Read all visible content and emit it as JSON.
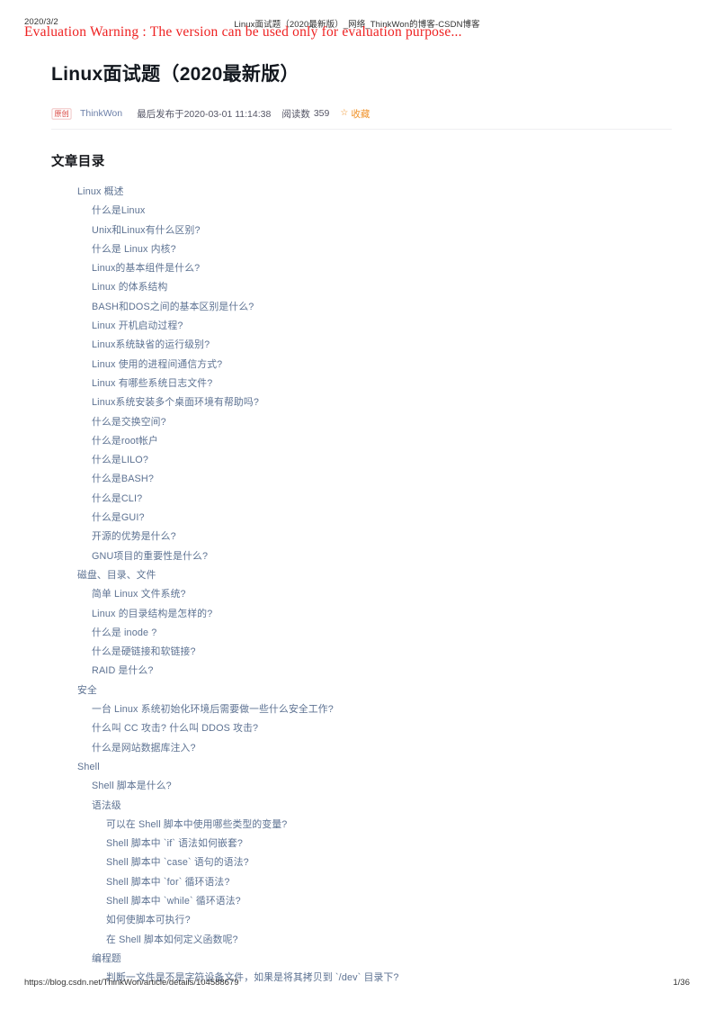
{
  "print_header": {
    "date": "2020/3/2",
    "title": "Linux面试题（2020最新版）_网络_ThinkWon的博客-CSDN博客"
  },
  "watermark": {
    "text": "Evaluation Warning : The version can be used only for evaluation purpose...",
    "color": "#ee2222"
  },
  "article": {
    "title": "Linux面试题（2020最新版）",
    "meta": {
      "badge": "原创",
      "author": "ThinkWon",
      "published": "最后发布于2020-03-01 11:14:38",
      "reads_label": "阅读数",
      "reads_count": "359",
      "favorite_icon": "star-icon",
      "favorite_label": "收藏"
    },
    "toc_heading": "文章目录",
    "toc": [
      {
        "level": 1,
        "label": "Linux 概述"
      },
      {
        "level": 2,
        "label": "什么是Linux"
      },
      {
        "level": 2,
        "label": "Unix和Linux有什么区别?"
      },
      {
        "level": 2,
        "label": "什么是 Linux 内核?"
      },
      {
        "level": 2,
        "label": "Linux的基本组件是什么?"
      },
      {
        "level": 2,
        "label": "Linux 的体系结构"
      },
      {
        "level": 2,
        "label": "BASH和DOS之间的基本区别是什么?"
      },
      {
        "level": 2,
        "label": "Linux 开机启动过程?"
      },
      {
        "level": 2,
        "label": "Linux系统缺省的运行级别?"
      },
      {
        "level": 2,
        "label": "Linux 使用的进程间通信方式?"
      },
      {
        "level": 2,
        "label": "Linux 有哪些系统日志文件?"
      },
      {
        "level": 2,
        "label": "Linux系统安装多个桌面环境有帮助吗?"
      },
      {
        "level": 2,
        "label": "什么是交换空间?"
      },
      {
        "level": 2,
        "label": "什么是root帐户"
      },
      {
        "level": 2,
        "label": "什么是LILO?"
      },
      {
        "level": 2,
        "label": "什么是BASH?"
      },
      {
        "level": 2,
        "label": "什么是CLI?"
      },
      {
        "level": 2,
        "label": "什么是GUI?"
      },
      {
        "level": 2,
        "label": "开源的优势是什么?"
      },
      {
        "level": 2,
        "label": "GNU项目的重要性是什么?"
      },
      {
        "level": 1,
        "label": "磁盘、目录、文件"
      },
      {
        "level": 2,
        "label": "简单 Linux 文件系统?"
      },
      {
        "level": 2,
        "label": "Linux 的目录结构是怎样的?"
      },
      {
        "level": 2,
        "label": "什么是 inode ?"
      },
      {
        "level": 2,
        "label": "什么是硬链接和软链接?"
      },
      {
        "level": 2,
        "label": "RAID 是什么?"
      },
      {
        "level": 1,
        "label": "安全"
      },
      {
        "level": 2,
        "label": "一台 Linux 系统初始化环境后需要做一些什么安全工作?"
      },
      {
        "level": 2,
        "label": "什么叫 CC 攻击? 什么叫 DDOS 攻击?"
      },
      {
        "level": 2,
        "label": "什么是网站数据库注入?"
      },
      {
        "level": 1,
        "label": "Shell"
      },
      {
        "level": 2,
        "label": "Shell 脚本是什么?"
      },
      {
        "level": 2,
        "label": "语法级"
      },
      {
        "level": 3,
        "label": "可以在 Shell 脚本中使用哪些类型的变量?"
      },
      {
        "level": 3,
        "label": "Shell 脚本中 `if` 语法如何嵌套?"
      },
      {
        "level": 3,
        "label": "Shell 脚本中 `case` 语句的语法?"
      },
      {
        "level": 3,
        "label": "Shell 脚本中 `for` 循环语法?"
      },
      {
        "level": 3,
        "label": "Shell 脚本中 `while` 循环语法?"
      },
      {
        "level": 3,
        "label": "如何使脚本可执行?"
      },
      {
        "level": 3,
        "label": "在 Shell 脚本如何定义函数呢?"
      },
      {
        "level": 2,
        "label": "编程题"
      },
      {
        "level": 3,
        "label": "判断一文件是不是字符设备文件，如果是将其拷贝到 `/dev` 目录下?"
      }
    ]
  },
  "print_footer": {
    "url": "https://blog.csdn.net/ThinkWon/article/details/104588679",
    "page": "1/36"
  }
}
